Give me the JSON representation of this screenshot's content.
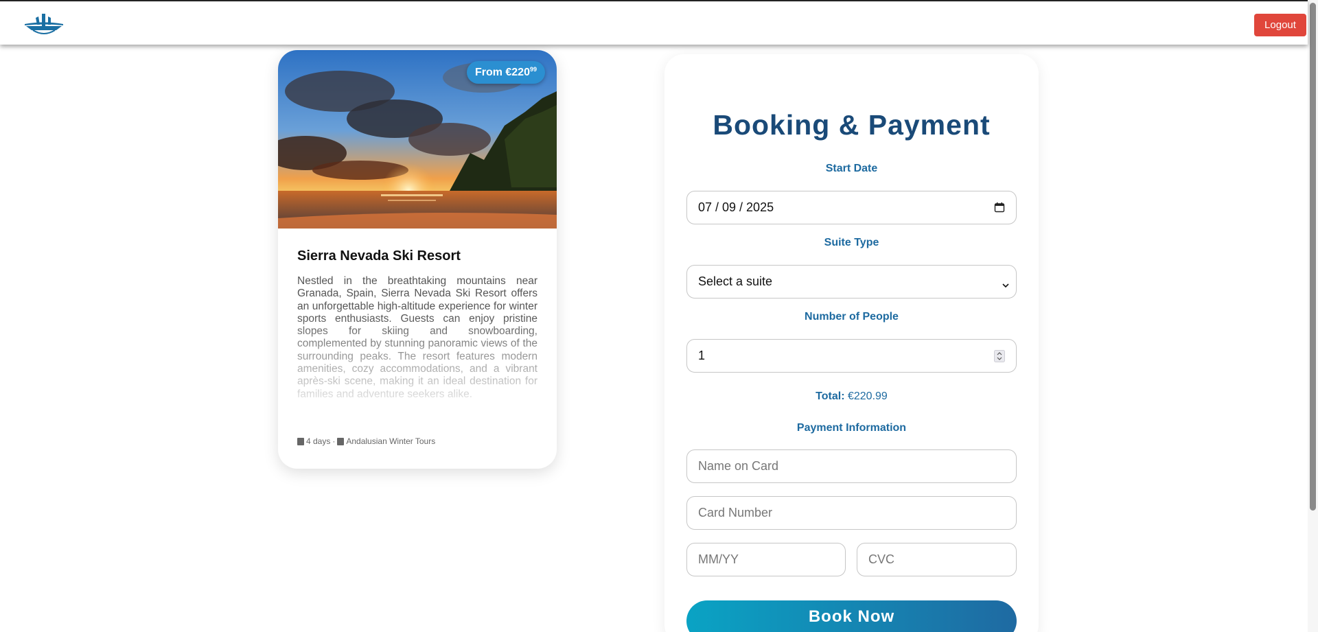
{
  "header": {
    "logout_label": "Logout",
    "logo_icon": "airplane-logo-icon"
  },
  "listing": {
    "price_prefix": "From €220",
    "price_cents": "99",
    "title": "Sierra Nevada Ski Resort",
    "description": "Nestled in the breathtaking mountains near Granada, Spain, Sierra Nevada Ski Resort offers an unforgettable high-altitude experience for winter sports enthusiasts. Guests can enjoy pristine slopes for skiing and snowboarding, complemented by stunning panoramic views of the surrounding peaks. The resort features modern amenities, cozy accommodations, and a vibrant après-ski scene, making it an ideal destination for families and adventure seekers alike.",
    "duration": "4 days",
    "separator": "·",
    "operator": "Andalusian Winter Tours"
  },
  "booking": {
    "title": "Booking & Payment",
    "start_date_label": "Start Date",
    "start_date_value": "07 / 09 / 2025",
    "suite_label": "Suite Type",
    "suite_value": "Select a suite",
    "people_label": "Number of People",
    "people_value": "1",
    "total_label": "Total:",
    "total_value": "€220.99",
    "payment_label": "Payment Information",
    "name_placeholder": "Name on Card",
    "card_placeholder": "Card Number",
    "expiry_placeholder": "MM/YY",
    "cvc_placeholder": "CVC",
    "book_label": "Book Now"
  },
  "colors": {
    "accent": "#1d6aa0",
    "title": "#1a4a78",
    "logout": "#e0463b",
    "badge": "#2b8fd1"
  }
}
